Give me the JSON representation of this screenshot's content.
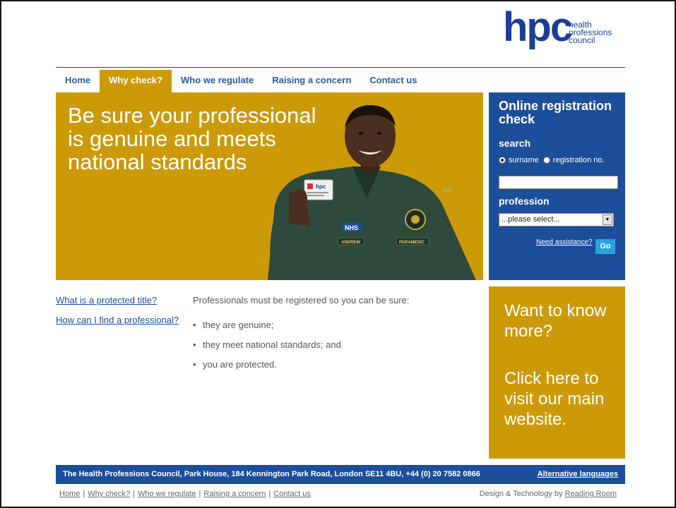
{
  "brand": {
    "logo_text": "hpc",
    "logo_subtext": "health professions council",
    "primary_color": "#1c4e9a",
    "accent_color": "#cc9a06"
  },
  "nav": [
    {
      "label": "Home",
      "active": false
    },
    {
      "label": "Why check?",
      "active": true
    },
    {
      "label": "Who we regulate",
      "active": false
    },
    {
      "label": "Raising a concern",
      "active": false
    },
    {
      "label": "Contact us",
      "active": false
    }
  ],
  "hero": {
    "headline": "Be sure your professional is genuine and meets national standards",
    "card_logo": "hpc",
    "badge_nhs": "NHS",
    "badge_name": "ANDREW",
    "badge_role": "PARAMEDIC"
  },
  "registration": {
    "title": "Online registration check",
    "search_label": "search",
    "radio_surname": "surname",
    "radio_regno": "registration no.",
    "profession_label": "profession",
    "profession_selected": "...please select...",
    "assistance_link": "Need assistance?",
    "go_button": "Go"
  },
  "side_links": [
    "What is a protected title?",
    "How can I find a professional?"
  ],
  "main": {
    "intro": "Professionals must be registered so you can be sure:",
    "bullets": [
      "they are genuine;",
      "they meet national standards; and",
      "you are protected."
    ]
  },
  "promo": {
    "line1": "Want to know more?",
    "line2": "Click here to visit our main website."
  },
  "footer": {
    "address": "The Health Professions Council, Park House, 184 Kennington Park Road, London SE11 4BU, +44 (0) 20 7582 0866",
    "alt_languages": "Alternative languages",
    "links": [
      "Home",
      "Why check?",
      "Who we regulate",
      "Raising a concern",
      "Contact us"
    ],
    "credit_prefix": "Design & Technology by",
    "credit_link": "Reading Room"
  }
}
